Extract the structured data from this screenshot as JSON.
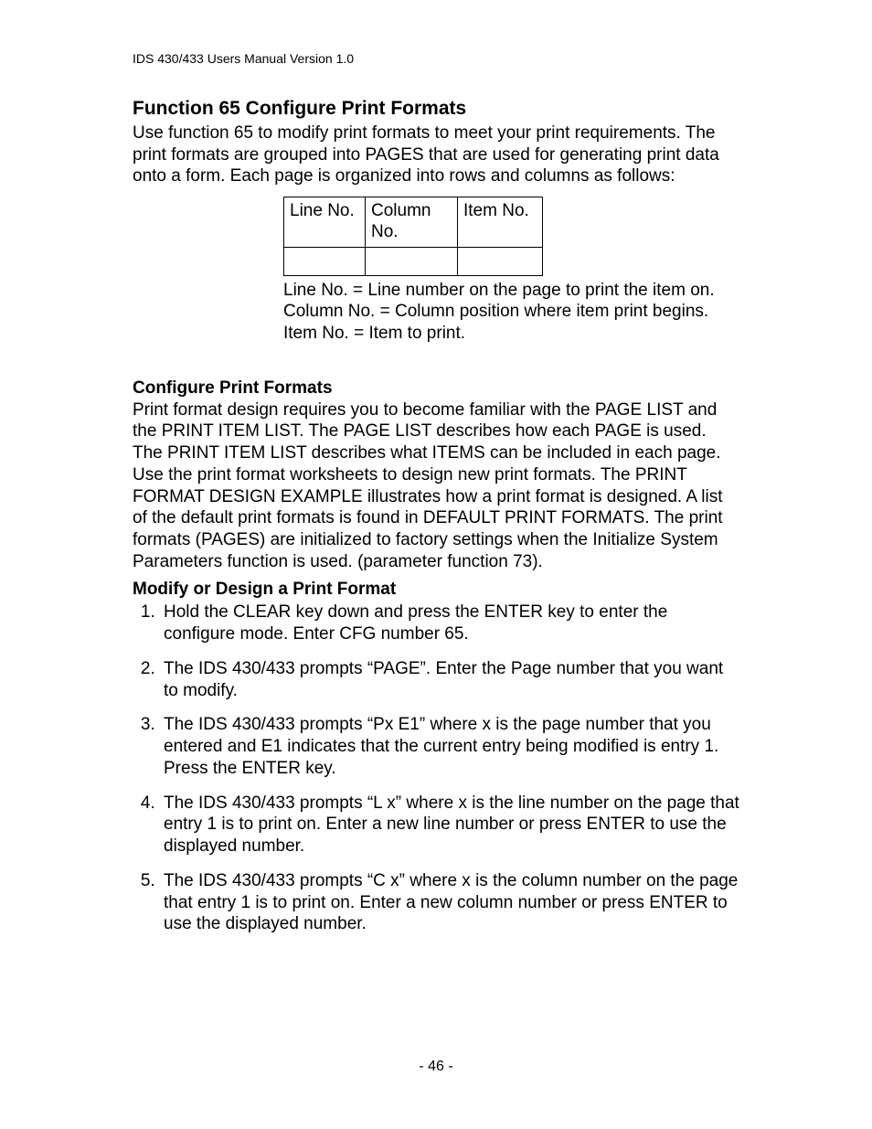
{
  "running_header": "IDS 430/433 Users Manual Version 1.0",
  "heading": "Function 65 Configure Print Formats",
  "intro": "Use function 65 to modify print formats to meet your print requirements. The print formats are grouped into PAGES that are used for generating print data onto a form. Each page is organized into rows and columns as follows:",
  "table": {
    "h0": "Line No.",
    "h1": "Column No.",
    "h2": "Item No."
  },
  "defs": {
    "d0": "Line No. = Line number on the page to print the item on.",
    "d1": "Column No. = Column position where item print begins.",
    "d2": "Item No. = Item to print."
  },
  "sub1_head": "Configure Print Formats",
  "sub1_body": "Print format design requires you to become familiar with the PAGE LIST and the PRINT ITEM LIST. The PAGE LIST describes how each PAGE is used. The PRINT ITEM LIST describes what ITEMS can be included in each page. Use the print format worksheets to design new print formats. The PRINT FORMAT DESIGN EXAMPLE illustrates how a print format is designed. A list of the default print formats is found in DEFAULT PRINT FORMATS. The print formats (PAGES) are initialized to factory settings when the Initialize System Parameters function is used. (parameter function 73).",
  "sub2_head": "Modify or Design a Print Format",
  "steps": [
    "Hold the CLEAR key down and press the ENTER key to enter the configure mode.  Enter CFG number 65.",
    "The IDS 430/433 prompts  “PAGE”. Enter the Page number that you want to modify.",
    "The IDS 430/433 prompts “Px E1” where x is the page number that you entered and E1 indicates that the current entry being modified is entry 1. Press the ENTER key.",
    "The IDS 430/433 prompts “L   x” where x is the line number on the page that entry 1 is to print on.  Enter a new line number or press ENTER to use the displayed number.",
    "The IDS 430/433 prompts “C   x” where x is the column number on the page that entry 1 is to print on. Enter a new column number or press ENTER to use the displayed number."
  ],
  "footer": "- 46 -"
}
